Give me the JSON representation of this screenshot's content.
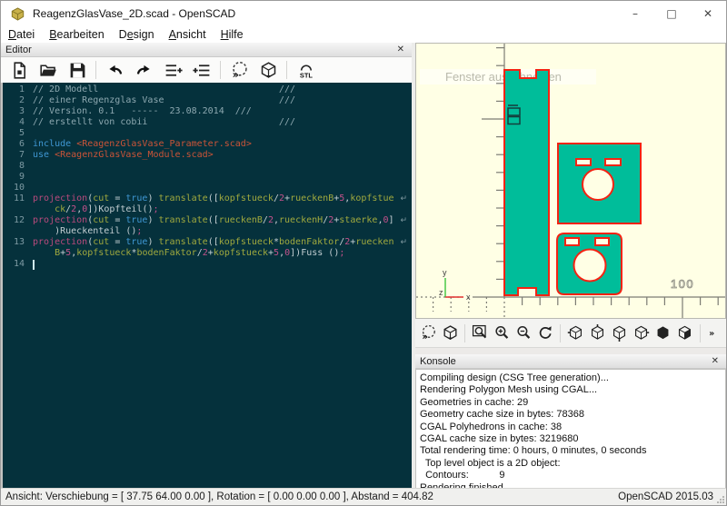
{
  "window": {
    "title": "ReagenzGlasVase_2D.scad - OpenSCAD",
    "controls": {
      "minimize": "–",
      "maximize": "□",
      "close": "✕"
    }
  },
  "menu": {
    "items": [
      {
        "name": "datei",
        "pre": "",
        "accel": "D",
        "post": "atei"
      },
      {
        "name": "bearbeiten",
        "pre": "",
        "accel": "B",
        "post": "earbeiten"
      },
      {
        "name": "design",
        "pre": "D",
        "accel": "e",
        "post": "sign"
      },
      {
        "name": "ansicht",
        "pre": "",
        "accel": "A",
        "post": "nsicht"
      },
      {
        "name": "hilfe",
        "pre": "",
        "accel": "H",
        "post": "ilfe"
      }
    ]
  },
  "editor": {
    "panel_title": "Editor",
    "close_glyph": "✕",
    "toolbar_groups": [
      [
        "new-file",
        "open-file",
        "save-file"
      ],
      [
        "undo",
        "redo",
        "unindent",
        "indent"
      ],
      [
        "preview",
        "render"
      ],
      [
        "export-stl"
      ]
    ],
    "wrap_marker": "↵",
    "code_rows": [
      {
        "n": "1",
        "tok": [
          [
            "cm",
            "// 2D Modell                                 ///"
          ]
        ]
      },
      {
        "n": "2",
        "tok": [
          [
            "cm",
            "// einer Regenzglas Vase                     ///"
          ]
        ]
      },
      {
        "n": "3",
        "tok": [
          [
            "cm",
            "// Version. 0.1   -----  23.08.2014  ///"
          ]
        ]
      },
      {
        "n": "4",
        "tok": [
          [
            "cm",
            "// erstellt von cobii                        ///"
          ]
        ]
      },
      {
        "n": "5",
        "tok": []
      },
      {
        "n": "6",
        "tok": [
          [
            "kw",
            "include"
          ],
          [
            "pl",
            " "
          ],
          [
            "str",
            "<ReagenzGlasVase_Parameter.scad>"
          ]
        ]
      },
      {
        "n": "7",
        "tok": [
          [
            "kw",
            "use"
          ],
          [
            "pl",
            " "
          ],
          [
            "str",
            "<ReagenzGlasVase_Module.scad>"
          ]
        ]
      },
      {
        "n": "8",
        "tok": []
      },
      {
        "n": "9",
        "tok": []
      },
      {
        "n": "10",
        "tok": []
      },
      {
        "n": "11",
        "wrap": true,
        "tok": [
          [
            "fn",
            "projection"
          ],
          [
            "pl",
            "("
          ],
          [
            "id",
            "cut"
          ],
          [
            "pl",
            " = "
          ],
          [
            "bool",
            "true"
          ],
          [
            "pl",
            ") "
          ],
          [
            "id",
            "translate"
          ],
          [
            "pl",
            "(["
          ],
          [
            "id",
            "kopfstueck"
          ],
          [
            "pl",
            "/"
          ],
          [
            "num",
            "2"
          ],
          [
            "pl",
            "+"
          ],
          [
            "id",
            "rueckenB"
          ],
          [
            "pl",
            "+"
          ],
          [
            "num",
            "5"
          ],
          [
            "pl",
            ","
          ],
          [
            "id",
            "kopfstue"
          ]
        ]
      },
      {
        "n": "",
        "tok": [
          [
            "pl",
            "    "
          ],
          [
            "id",
            "ck"
          ],
          [
            "pl",
            "/"
          ],
          [
            "num",
            "2"
          ],
          [
            "pl",
            ","
          ],
          [
            "num",
            "0"
          ],
          [
            "pl",
            "])"
          ],
          [
            "pl",
            "Kopfteil"
          ],
          [
            "pl",
            "()"
          ],
          [
            "num",
            ";"
          ]
        ]
      },
      {
        "n": "12",
        "wrap": true,
        "tok": [
          [
            "fn",
            "projection"
          ],
          [
            "pl",
            "("
          ],
          [
            "id",
            "cut"
          ],
          [
            "pl",
            " = "
          ],
          [
            "bool",
            "true"
          ],
          [
            "pl",
            ") "
          ],
          [
            "id",
            "translate"
          ],
          [
            "pl",
            "(["
          ],
          [
            "id",
            "rueckenB"
          ],
          [
            "pl",
            "/"
          ],
          [
            "num",
            "2"
          ],
          [
            "pl",
            ","
          ],
          [
            "id",
            "rueckenH"
          ],
          [
            "pl",
            "/"
          ],
          [
            "num",
            "2"
          ],
          [
            "pl",
            "+"
          ],
          [
            "id",
            "staerke"
          ],
          [
            "pl",
            ","
          ],
          [
            "num",
            "0"
          ],
          [
            "pl",
            "]"
          ]
        ]
      },
      {
        "n": "",
        "tok": [
          [
            "pl",
            "    )"
          ],
          [
            "pl",
            "Rueckenteil "
          ],
          [
            "pl",
            "()"
          ],
          [
            "num",
            ";"
          ]
        ]
      },
      {
        "n": "13",
        "wrap": true,
        "tok": [
          [
            "fn",
            "projection"
          ],
          [
            "pl",
            "("
          ],
          [
            "id",
            "cut"
          ],
          [
            "pl",
            " = "
          ],
          [
            "bool",
            "true"
          ],
          [
            "pl",
            ") "
          ],
          [
            "id",
            "translate"
          ],
          [
            "pl",
            "(["
          ],
          [
            "id",
            "kopfstueck"
          ],
          [
            "pl",
            "*"
          ],
          [
            "id",
            "bodenFaktor"
          ],
          [
            "pl",
            "/"
          ],
          [
            "num",
            "2"
          ],
          [
            "pl",
            "+"
          ],
          [
            "id",
            "ruecken"
          ]
        ]
      },
      {
        "n": "",
        "tok": [
          [
            "pl",
            "    "
          ],
          [
            "id",
            "B"
          ],
          [
            "pl",
            "+"
          ],
          [
            "num",
            "5"
          ],
          [
            "pl",
            ","
          ],
          [
            "id",
            "kopfstueck"
          ],
          [
            "pl",
            "*"
          ],
          [
            "id",
            "bodenFaktor"
          ],
          [
            "pl",
            "/"
          ],
          [
            "num",
            "2"
          ],
          [
            "pl",
            "+"
          ],
          [
            "id",
            "kopfstueck"
          ],
          [
            "pl",
            "+"
          ],
          [
            "num",
            "5"
          ],
          [
            "pl",
            ","
          ],
          [
            "num",
            "0"
          ],
          [
            "pl",
            "])"
          ],
          [
            "pl",
            "Fuss "
          ],
          [
            "pl",
            "()"
          ],
          [
            "num",
            ";"
          ]
        ]
      },
      {
        "n": "14",
        "cursor": true,
        "tok": []
      }
    ]
  },
  "viewport": {
    "overlay_text": "Fenster ausschneiden",
    "axis": {
      "x_major_label": "100",
      "x_label": "x",
      "y_label": "y",
      "z_label": "z"
    },
    "colors": {
      "background": "#FFFFE5",
      "fill": "#00BD9A",
      "outline": "#F32313"
    },
    "toolbar_groups": [
      [
        "preview",
        "render"
      ],
      [
        "zoom-all",
        "zoom-in",
        "zoom-out",
        "reset-view"
      ],
      [
        "view-right",
        "view-top",
        "view-bottom",
        "view-left",
        "view-front",
        "view-back"
      ],
      [
        "more"
      ]
    ]
  },
  "console": {
    "panel_title": "Konsole",
    "close_glyph": "✕",
    "lines": [
      "Compiling design (CSG Tree generation)...",
      "Rendering Polygon Mesh using CGAL...",
      "Geometries in cache: 29",
      "Geometry cache size in bytes: 78368",
      "CGAL Polyhedrons in cache: 38",
      "CGAL cache size in bytes: 3219680",
      "Total rendering time: 0 hours, 0 minutes, 0 seconds",
      "  Top level object is a 2D object:",
      "  Contours:           9",
      "Rendering finished."
    ]
  },
  "statusbar": {
    "left": "Ansicht: Verschiebung = [ 37.75 64.00 0.00 ], Rotation = [ 0.00 0.00 0.00 ], Abstand = 404.82",
    "right": "OpenSCAD 2015.03"
  }
}
